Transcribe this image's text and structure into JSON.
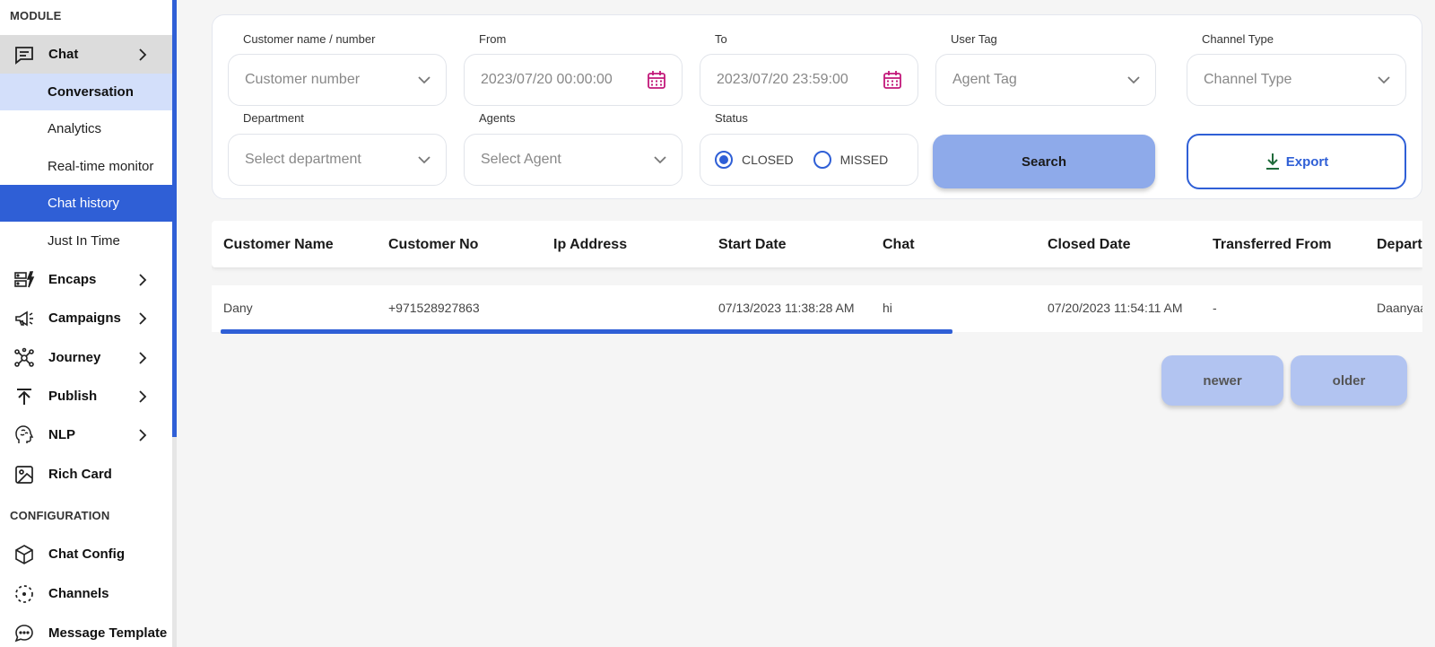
{
  "sidebar": {
    "module_label": "MODULE",
    "configuration_label": "CONFIGURATION",
    "chat": {
      "label": "Chat",
      "icon": "chat-lines-icon"
    },
    "chat_subitems": [
      {
        "label": "Conversation"
      },
      {
        "label": "Analytics"
      },
      {
        "label": "Real-time monitor"
      },
      {
        "label": "Chat history"
      },
      {
        "label": "Just In Time"
      }
    ],
    "modules": [
      {
        "label": "Encaps",
        "icon": "encaps-icon"
      },
      {
        "label": "Campaigns",
        "icon": "megaphone-icon"
      },
      {
        "label": "Journey",
        "icon": "network-icon"
      },
      {
        "label": "Publish",
        "icon": "publish-icon"
      },
      {
        "label": "NLP",
        "icon": "brain-head-icon"
      },
      {
        "label": "Rich Card",
        "icon": "image-card-icon"
      }
    ],
    "config_items": [
      {
        "label": "Chat Config",
        "icon": "cube-icon"
      },
      {
        "label": "Channels",
        "icon": "channels-icon"
      },
      {
        "label": "Message Template",
        "icon": "message-bubble-icon"
      }
    ]
  },
  "filters": {
    "customer": {
      "label": "Customer name / number",
      "placeholder": "Customer number"
    },
    "from": {
      "label": "From",
      "value": "2023/07/20 00:00:00"
    },
    "to": {
      "label": "To",
      "value": "2023/07/20 23:59:00"
    },
    "user_tag": {
      "label": "User Tag",
      "placeholder": "Agent Tag"
    },
    "channel_type": {
      "label": "Channel Type",
      "placeholder": "Channel Type"
    },
    "department": {
      "label": "Department",
      "placeholder": "Select department"
    },
    "agents": {
      "label": "Agents",
      "placeholder": "Select Agent"
    },
    "status": {
      "label": "Status",
      "options": [
        {
          "label": "CLOSED",
          "selected": true
        },
        {
          "label": "MISSED",
          "selected": false
        }
      ]
    },
    "search_label": "Search",
    "export_label": "Export"
  },
  "table": {
    "columns": [
      "Customer Name",
      "Customer No",
      "Ip Address",
      "Start Date",
      "Chat",
      "Closed Date",
      "Transferred From",
      "Depart"
    ],
    "rows": [
      [
        "Dany",
        "+971528927863",
        "",
        "07/13/2023 11:38:28 AM",
        "hi",
        "07/20/2023 11:54:11 AM",
        "-",
        "Daanyaa"
      ]
    ]
  },
  "pagination": {
    "newer_label": "newer",
    "older_label": "older"
  },
  "colors": {
    "accent": "#2f5fd6",
    "selected_bg": "#d3dffa",
    "search_button": "#8eaaea",
    "pagination_button": "#b2c4f1",
    "calendar_icon": "#c2187a"
  }
}
